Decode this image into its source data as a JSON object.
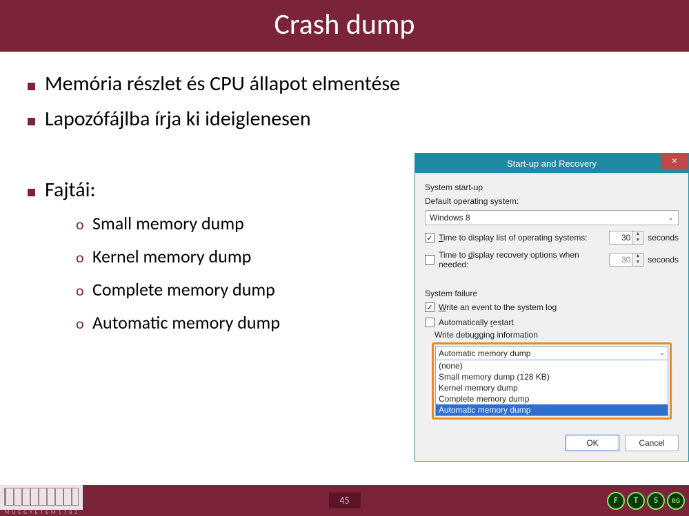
{
  "title": "Crash dump",
  "bullets": {
    "b1": "Memória részlet és CPU állapot elmentése",
    "b2": "Lapozófájlba írja ki ideiglenesen",
    "b3": "Fajtái:"
  },
  "subs": {
    "s1": "Small memory dump",
    "s2": "Kernel memory dump",
    "s3": "Complete memory dump",
    "s4": "Automatic memory dump"
  },
  "dialog": {
    "title": "Start-up and Recovery",
    "group1": "System start-up",
    "default_os_label": "Default operating system:",
    "default_os_value": "Windows 8",
    "time_list_label": "Time to display list of operating systems:",
    "time_list_value": "30",
    "time_recovery_label": "Time to display recovery options when needed:",
    "time_recovery_value": "30",
    "seconds": "seconds",
    "group2": "System failure",
    "write_event": "Write an event to the system log",
    "auto_restart": "Automatically restart",
    "write_debug": "Write debugging information",
    "dump_selected": "Automatic memory dump",
    "dump_options": {
      "o1": "(none)",
      "o2": "Small memory dump (128 KB)",
      "o3": "Kernel memory dump",
      "o4": "Complete memory dump",
      "o5": "Automatic memory dump"
    },
    "ok": "OK",
    "cancel": "Cancel"
  },
  "footer": {
    "logo_text": "M Ű E G Y E T E M  1 7 8 2",
    "page": "45",
    "right": {
      "a": "F",
      "b": "T",
      "c": "S",
      "d": "RG"
    }
  }
}
